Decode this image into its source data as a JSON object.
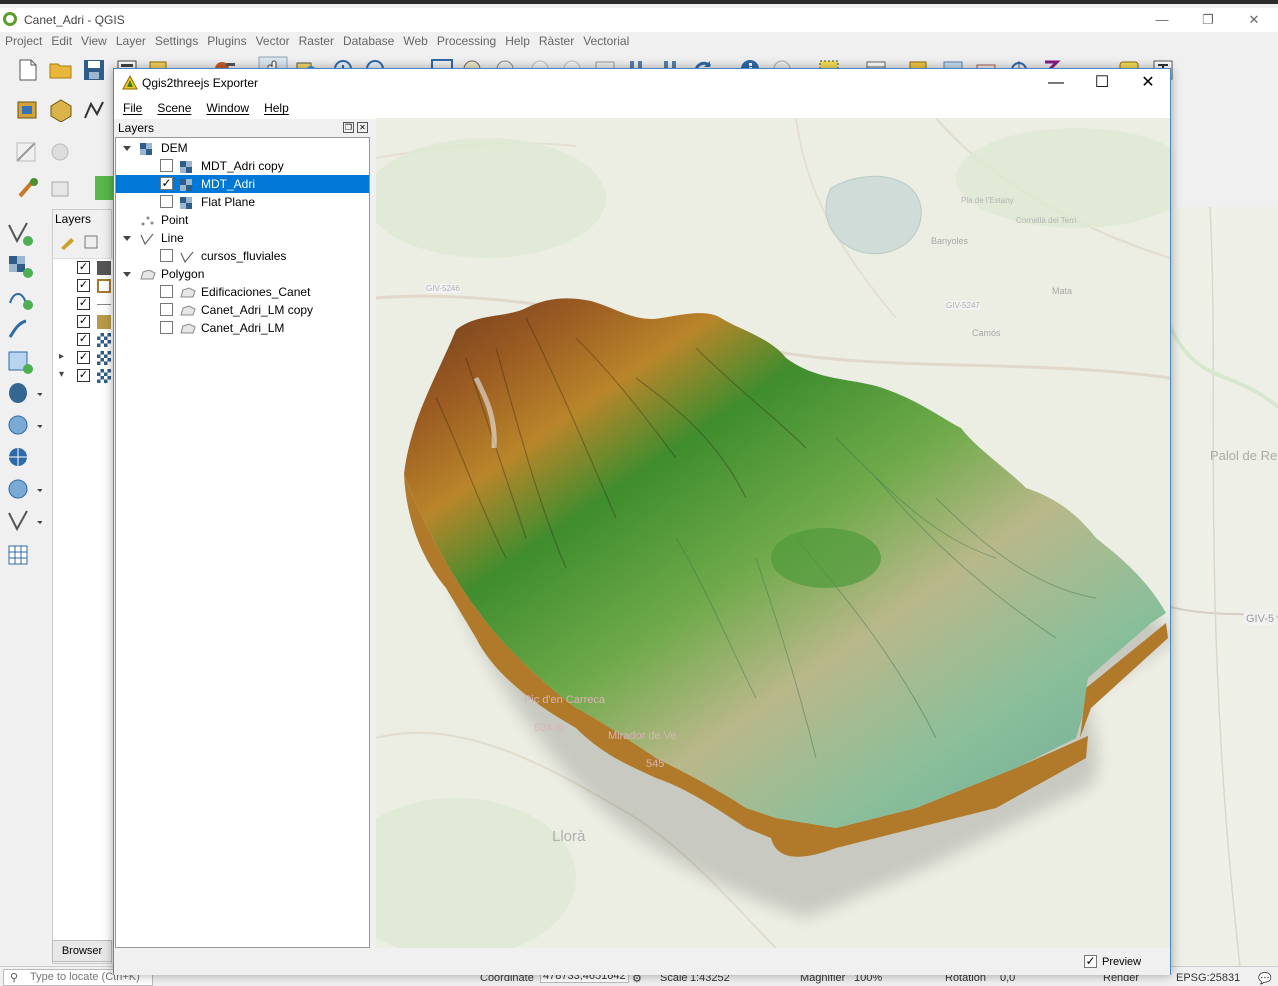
{
  "qgis": {
    "title": "Canet_Adri - QGIS",
    "menu": [
      "Project",
      "Edit",
      "View",
      "Layer",
      "Settings",
      "Plugins",
      "Vector",
      "Raster",
      "Database",
      "Web",
      "Processing",
      "Help",
      "Ràster",
      "Vectorial"
    ],
    "layers_title": "Layers",
    "browser_tab": "Browser",
    "layer_checks": [
      true,
      true,
      true,
      true,
      true,
      true,
      true
    ],
    "status": {
      "locate_placeholder": "Type to locate (Ctrl+K)",
      "coordinate_label": "Coordinate",
      "coordinate": "478733,4651642",
      "scale_label": "Scale",
      "scale": "1:43252",
      "magnifier_label": "Magnifier",
      "magnifier": "100%",
      "rotation_label": "Rotation",
      "rotation": "0,0",
      "render_label": "Render",
      "crs": "EPSG:25831"
    },
    "map_labels": {
      "right1": "Palol de Re",
      "right2": "GIV-5"
    }
  },
  "exporter": {
    "title": "Qgis2threejs Exporter",
    "menu": [
      "File",
      "Scene",
      "Window",
      "Help"
    ],
    "panel_title": "Layers",
    "tree": [
      {
        "label": "DEM",
        "type": "group",
        "level": 0,
        "expanded": true,
        "icon": "raster-icon"
      },
      {
        "label": "MDT_Adri copy",
        "type": "layer",
        "level": 1,
        "checked": false,
        "icon": "raster-icon"
      },
      {
        "label": "MDT_Adri",
        "type": "layer",
        "level": 1,
        "checked": true,
        "selected": true,
        "icon": "raster-icon"
      },
      {
        "label": "Flat Plane",
        "type": "layer",
        "level": 1,
        "checked": false,
        "icon": "raster-icon"
      },
      {
        "label": "Point",
        "type": "group",
        "level": 0,
        "expanded": false,
        "icon": "point-icon"
      },
      {
        "label": "Line",
        "type": "group",
        "level": 0,
        "expanded": true,
        "icon": "line-icon"
      },
      {
        "label": "cursos_fluviales",
        "type": "layer",
        "level": 1,
        "checked": false,
        "icon": "line-icon"
      },
      {
        "label": "Polygon",
        "type": "group",
        "level": 0,
        "expanded": true,
        "icon": "polygon-icon"
      },
      {
        "label": "Edificaciones_Canet",
        "type": "layer",
        "level": 1,
        "checked": false,
        "icon": "polygon-icon"
      },
      {
        "label": "Canet_Adri_LM copy",
        "type": "layer",
        "level": 1,
        "checked": false,
        "icon": "polygon-icon"
      },
      {
        "label": "Canet_Adri_LM",
        "type": "layer",
        "level": 1,
        "checked": false,
        "icon": "polygon-icon"
      }
    ],
    "preview_label": "Preview",
    "preview_checked": true,
    "map_labels": [
      "Banyoles",
      "Pla de l'Estany",
      "Mata",
      "Camós",
      "Pic d'en Carreca",
      "524 m",
      "Mirador de Ve",
      "545",
      "Llorà",
      "GIV-5246",
      "GIV-5247",
      "Cornellà del Terri"
    ]
  }
}
